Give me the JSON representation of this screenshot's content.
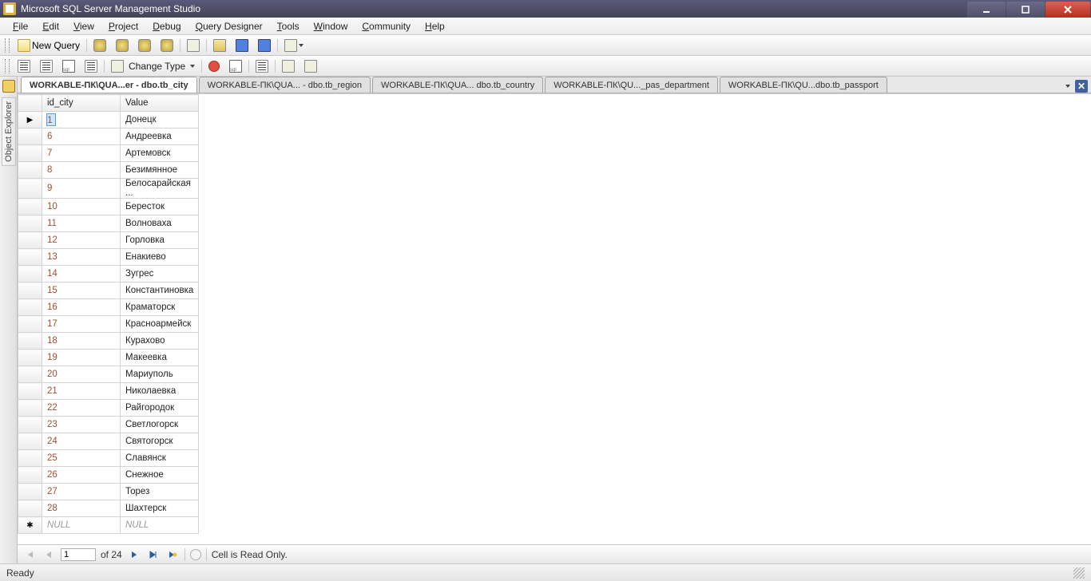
{
  "app": {
    "title": "Microsoft SQL Server Management Studio"
  },
  "menu": {
    "file": "File",
    "edit": "Edit",
    "view": "View",
    "project": "Project",
    "debug": "Debug",
    "qd": "Query Designer",
    "tools": "Tools",
    "window": "Window",
    "community": "Community",
    "help": "Help"
  },
  "toolbar": {
    "new_query": "New Query",
    "change_type": "Change Type"
  },
  "side": {
    "object_explorer": "Object Explorer"
  },
  "tabs": [
    {
      "label": "WORKABLE-ПК\\QUA...er - dbo.tb_city",
      "active": true
    },
    {
      "label": "WORKABLE-ПК\\QUA... - dbo.tb_region",
      "active": false
    },
    {
      "label": "WORKABLE-ПК\\QUA... dbo.tb_country",
      "active": false
    },
    {
      "label": "WORKABLE-ПК\\QU..._pas_department",
      "active": false
    },
    {
      "label": "WORKABLE-ПК\\QU...dbo.tb_passport",
      "active": false
    }
  ],
  "grid": {
    "columns": {
      "id": "id_city",
      "value": "Value"
    },
    "rows": [
      {
        "id": "1",
        "value": "Донецк",
        "current": true
      },
      {
        "id": "6",
        "value": "Андреевка"
      },
      {
        "id": "7",
        "value": "Артемовск"
      },
      {
        "id": "8",
        "value": "Безимянное"
      },
      {
        "id": "9",
        "value": "Белосарайская ..."
      },
      {
        "id": "10",
        "value": "Бересток"
      },
      {
        "id": "11",
        "value": "Волноваха"
      },
      {
        "id": "12",
        "value": "Горловка"
      },
      {
        "id": "13",
        "value": "Енакиево"
      },
      {
        "id": "14",
        "value": "Зугрес"
      },
      {
        "id": "15",
        "value": "Константиновка"
      },
      {
        "id": "16",
        "value": "Краматорск"
      },
      {
        "id": "17",
        "value": "Красноармейск"
      },
      {
        "id": "18",
        "value": "Курахово"
      },
      {
        "id": "19",
        "value": "Макеевка"
      },
      {
        "id": "20",
        "value": "Мариуполь"
      },
      {
        "id": "21",
        "value": "Николаевка"
      },
      {
        "id": "22",
        "value": "Райгородок"
      },
      {
        "id": "23",
        "value": "Светлогорск"
      },
      {
        "id": "24",
        "value": "Святогорск"
      },
      {
        "id": "25",
        "value": "Славянск"
      },
      {
        "id": "26",
        "value": "Снежное"
      },
      {
        "id": "27",
        "value": "Торез"
      },
      {
        "id": "28",
        "value": "Шахтерск"
      }
    ],
    "null_label": "NULL"
  },
  "nav": {
    "pos": "1",
    "of_label": "of 24",
    "readonly": "Cell is Read Only."
  },
  "status": {
    "ready": "Ready"
  }
}
